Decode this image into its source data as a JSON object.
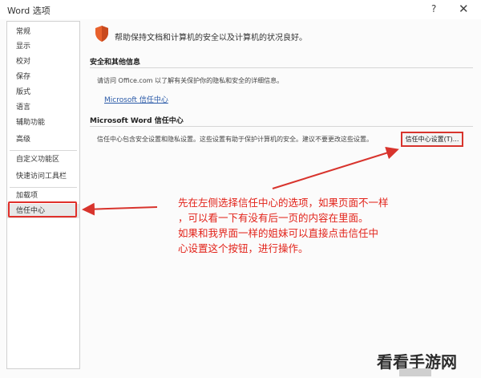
{
  "window": {
    "title": "Word 选项",
    "help_glyph": "?",
    "close_glyph": "✕"
  },
  "sidebar": {
    "items": [
      {
        "label": "常规"
      },
      {
        "label": "显示"
      },
      {
        "label": "校对"
      },
      {
        "label": "保存"
      },
      {
        "label": "版式"
      },
      {
        "label": "语言"
      },
      {
        "label": "辅助功能"
      },
      {
        "label": "高级"
      },
      {
        "label": "自定义功能区"
      },
      {
        "label": "快速访问工具栏"
      },
      {
        "label": "加载项"
      },
      {
        "label": "信任中心"
      }
    ],
    "selected": "信任中心"
  },
  "main": {
    "headline": "帮助保持文档和计算机的安全以及计算机的状况良好。",
    "privacy_section": {
      "title": "安全和其他信息",
      "text": "请访问 Office.com 以了解有关保护你的隐私和安全的详细信息。",
      "link": "Microsoft 信任中心"
    },
    "trust_section": {
      "title": "Microsoft Word 信任中心",
      "text": "信任中心包含安全设置和隐私设置。这些设置有助于保护计算机的安全。建议不要更改这些设置。",
      "button_label": "信任中心设置(T)..."
    }
  },
  "annotation": {
    "line1": "先在左侧选择信任中心的选项，如果页面不一样",
    "line2": "，可以看一下有没有后一页的内容在里面。",
    "line3": "如果和我界面一样的姐妹可以直接点击信任中",
    "line4": "心设置这个按钮，进行操作。"
  },
  "watermark": {
    "text": "看看手游网"
  },
  "colors": {
    "annotation_red": "#e2231a",
    "link_blue": "#2a5aa8",
    "shield_orange": "#e8612c"
  },
  "icons": {
    "shield": "shield-icon",
    "help": "help-icon",
    "close": "close-icon"
  }
}
